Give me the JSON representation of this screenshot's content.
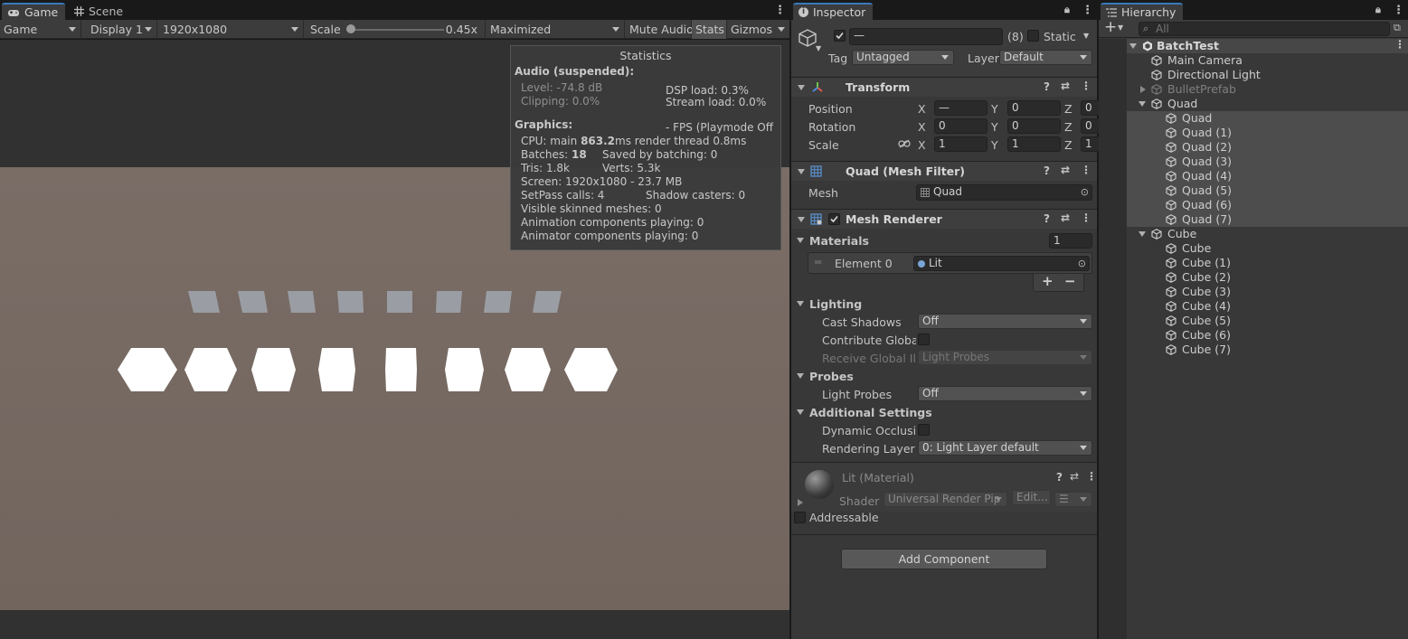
{
  "game_panel": {
    "tabs": [
      {
        "label": "Game",
        "icon": "gamepad-icon"
      },
      {
        "label": "Scene",
        "icon": "grid-icon"
      }
    ],
    "toolbar": {
      "mode": "Game",
      "display": "Display 1",
      "resolution": "1920x1080",
      "scale_label": "Scale",
      "scale_value": "0.45x",
      "scale_fraction": 0.05,
      "maximize": "Maximized",
      "mute": "Mute Audio",
      "stats": "Stats",
      "gizmos": "Gizmos"
    },
    "statistics": {
      "title": "Statistics",
      "audio_header": "Audio (suspended):",
      "level": "Level: -74.8 dB",
      "clipping": "Clipping: 0.0%",
      "dsp": "DSP load: 0.3%",
      "stream": "Stream load: 0.0%",
      "graphics_header": "Graphics:",
      "fps": "- FPS (Playmode Off",
      "cpu_prefix": "CPU: main ",
      "cpu_main": "863.2",
      "cpu_suffix": "ms  render thread 0.8ms",
      "batches_prefix": "Batches: ",
      "batches": "18",
      "saved": "Saved by batching: 0",
      "tris": "Tris: 1.8k",
      "verts": "Verts: 5.3k",
      "screen": "Screen: 1920x1080 - 23.7 MB",
      "setpass": "SetPass calls: 4",
      "shadow": "Shadow casters: 0",
      "skinned": "Visible skinned meshes: 0",
      "anim": "Animation components playing: 0",
      "animator": "Animator components playing: 0"
    }
  },
  "inspector": {
    "tab_label": "Inspector",
    "object_name": "—",
    "count": "(8)",
    "static_label": "Static",
    "tag_label": "Tag",
    "tag_value": "Untagged",
    "layer_label": "Layer",
    "layer_value": "Default",
    "transform": {
      "title": "Transform",
      "rows": [
        {
          "label": "Position",
          "x": "—",
          "y": "0",
          "z": "0"
        },
        {
          "label": "Rotation",
          "x": "0",
          "y": "0",
          "z": "0"
        },
        {
          "label": "Scale",
          "x": "1",
          "y": "1",
          "z": "1"
        }
      ],
      "axis_x": "X",
      "axis_y": "Y",
      "axis_z": "Z"
    },
    "mesh_filter": {
      "title": "Quad (Mesh Filter)",
      "mesh_label": "Mesh",
      "mesh_value": "Quad"
    },
    "mesh_renderer": {
      "title": "Mesh Renderer",
      "materials_label": "Materials",
      "materials_count": "1",
      "element_label": "Element 0",
      "element_value": "Lit",
      "add": "+",
      "remove": "−",
      "lighting_label": "Lighting",
      "cast_shadows_label": "Cast Shadows",
      "cast_shadows_value": "Off",
      "contribute_label": "Contribute Global I",
      "receive_label": "Receive Global Illu",
      "receive_value": "Light Probes",
      "probes_label": "Probes",
      "light_probes_label": "Light Probes",
      "light_probes_value": "Off",
      "additional_label": "Additional Settings",
      "dynamic_label": "Dynamic Occlusion",
      "rendering_layer_label": "Rendering Layer M",
      "rendering_layer_value": "0: Light Layer default"
    },
    "material": {
      "title": "Lit (Material)",
      "shader_label": "Shader",
      "shader_value": "Universal Render Pip",
      "edit": "Edit..."
    },
    "addressable": "Addressable",
    "add_component": "Add Component"
  },
  "hierarchy": {
    "tab_label": "Hierarchy",
    "search_placeholder": "All",
    "scene": "BatchTest",
    "items": [
      {
        "label": "Main Camera",
        "depth": 1
      },
      {
        "label": "Directional Light",
        "depth": 1
      },
      {
        "label": "BulletPrefab",
        "depth": 1,
        "dim": true,
        "collapsed": true
      },
      {
        "label": "Quad",
        "depth": 1,
        "expanded": true
      },
      {
        "label": "Quad",
        "depth": 2,
        "selected": true
      },
      {
        "label": "Quad (1)",
        "depth": 2,
        "selected": true
      },
      {
        "label": "Quad (2)",
        "depth": 2,
        "selected": true
      },
      {
        "label": "Quad (3)",
        "depth": 2,
        "selected": true
      },
      {
        "label": "Quad (4)",
        "depth": 2,
        "selected": true
      },
      {
        "label": "Quad (5)",
        "depth": 2,
        "selected": true
      },
      {
        "label": "Quad (6)",
        "depth": 2,
        "selected": true
      },
      {
        "label": "Quad (7)",
        "depth": 2,
        "selected": true
      },
      {
        "label": "Cube",
        "depth": 1,
        "expanded": true
      },
      {
        "label": "Cube",
        "depth": 2
      },
      {
        "label": "Cube (1)",
        "depth": 2
      },
      {
        "label": "Cube (2)",
        "depth": 2
      },
      {
        "label": "Cube (3)",
        "depth": 2
      },
      {
        "label": "Cube (4)",
        "depth": 2
      },
      {
        "label": "Cube (5)",
        "depth": 2
      },
      {
        "label": "Cube (6)",
        "depth": 2
      },
      {
        "label": "Cube (7)",
        "depth": 2
      }
    ]
  },
  "colors": {
    "accent": "#3a79bb",
    "selection": "#4d4d4d",
    "game_bg": "#73665f",
    "quad_gray": "#9a9ea4"
  }
}
